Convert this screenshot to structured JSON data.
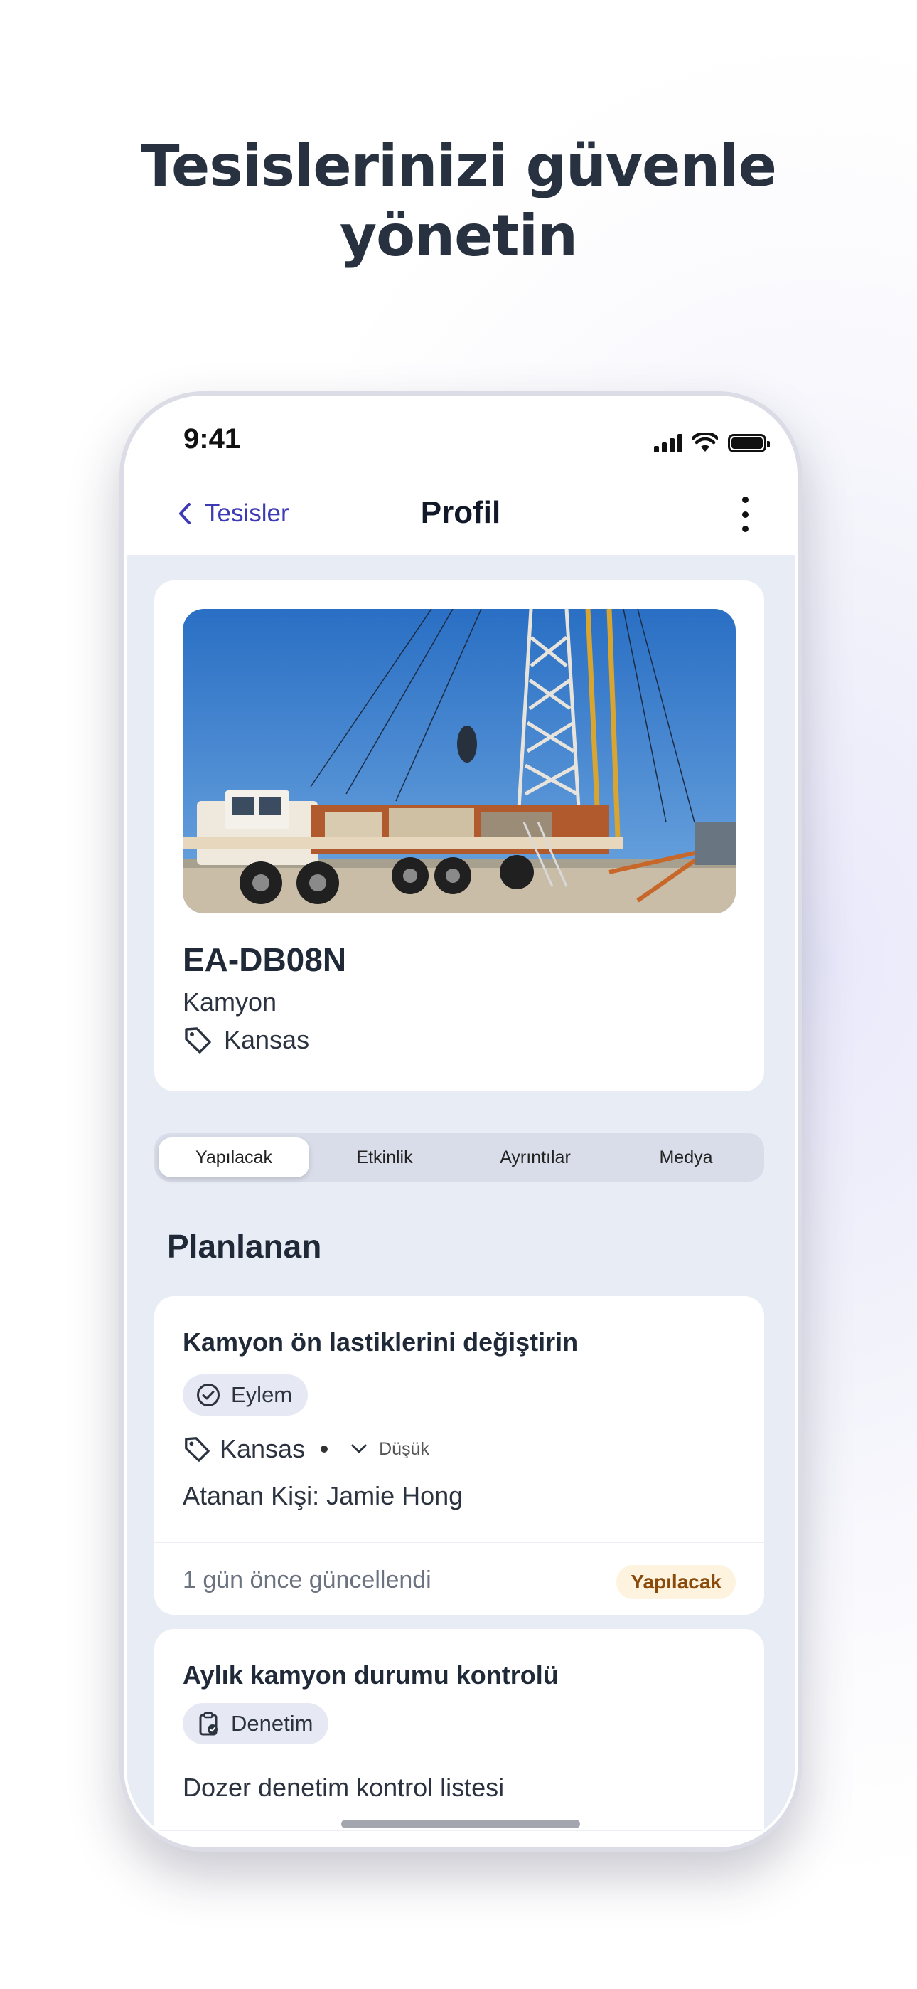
{
  "headline": {
    "line1": "Tesislerinizi güvenle",
    "line2": "yönetin"
  },
  "status_bar": {
    "time": "9:41"
  },
  "nav": {
    "back_label": "Tesisler",
    "title": "Profil"
  },
  "asset": {
    "id": "EA-DB08N",
    "type": "Kamyon",
    "location": "Kansas"
  },
  "tabs": [
    {
      "label": "Yapılacak",
      "active": true
    },
    {
      "label": "Etkinlik",
      "active": false
    },
    {
      "label": "Ayrıntılar",
      "active": false
    },
    {
      "label": "Medya",
      "active": false
    }
  ],
  "section_title": "Planlanan",
  "tasks": [
    {
      "title": "Kamyon ön lastiklerini değiştirin",
      "chip": "Eylem",
      "location": "Kansas",
      "priority": "Düşük",
      "assignee": "Atanan Kişi: Jamie Hong",
      "updated": "1 gün önce güncellendi",
      "status": "Yapılacak"
    },
    {
      "title": "Aylık kamyon durumu kontrolü",
      "chip": "Denetim",
      "description": "Dozer denetim kontrol listesi"
    }
  ],
  "colors": {
    "accent": "#3d3ab5",
    "status_bg": "#fdf3df",
    "status_text": "#8a4a0a",
    "screen_bg": "#e8ecf5"
  }
}
